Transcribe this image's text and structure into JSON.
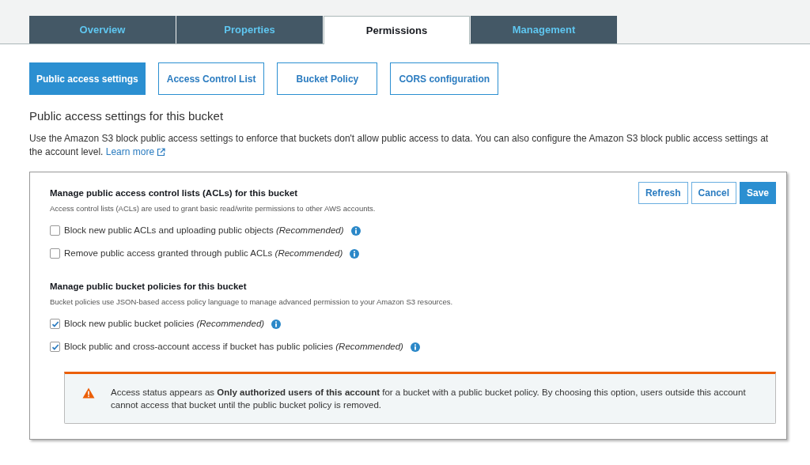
{
  "tabs": [
    {
      "label": "Overview",
      "selected": false
    },
    {
      "label": "Properties",
      "selected": false
    },
    {
      "label": "Permissions",
      "selected": true
    },
    {
      "label": "Management",
      "selected": false
    }
  ],
  "subtabs": [
    {
      "label": "Public access settings",
      "selected": true
    },
    {
      "label": "Access Control List",
      "selected": false
    },
    {
      "label": "Bucket Policy",
      "selected": false
    },
    {
      "label": "CORS configuration",
      "selected": false
    }
  ],
  "heading": "Public access settings for this bucket",
  "description": "Use the Amazon S3 block public access settings to enforce that buckets don't allow public access to data. You can also configure the Amazon S3 block public access settings at the account level.",
  "learn_more": "Learn more",
  "buttons": [
    {
      "label": "Refresh",
      "primary": false
    },
    {
      "label": "Cancel",
      "primary": false
    },
    {
      "label": "Save",
      "primary": true
    }
  ],
  "sections": [
    {
      "title": "Manage public access control lists (ACLs) for this bucket",
      "description": "Access control lists (ACLs) are used to grant basic read/write permissions to other AWS accounts.",
      "options": [
        {
          "label": "Block new public ACLs and uploading public objects *(Recommended)*",
          "checked": false
        },
        {
          "label": "Remove public access granted through public ACLs *(Recommended)*",
          "checked": false
        }
      ]
    },
    {
      "title": "Manage public bucket policies for this bucket",
      "description": "Bucket policies use JSON-based access policy language to manage advanced permission to your Amazon S3 resources.",
      "options": [
        {
          "label": "Block new public bucket policies *(Recommended)*",
          "checked": true
        },
        {
          "label": "Block public and cross-account access if bucket has public policies *(Recommended)*",
          "checked": true
        }
      ]
    }
  ],
  "alert": {
    "text": "Access status appears as **Only authorized users of this account** for a bucket with a public bucket policy. By choosing this option, users outside this account cannot access that bucket until the public bucket policy is removed."
  }
}
